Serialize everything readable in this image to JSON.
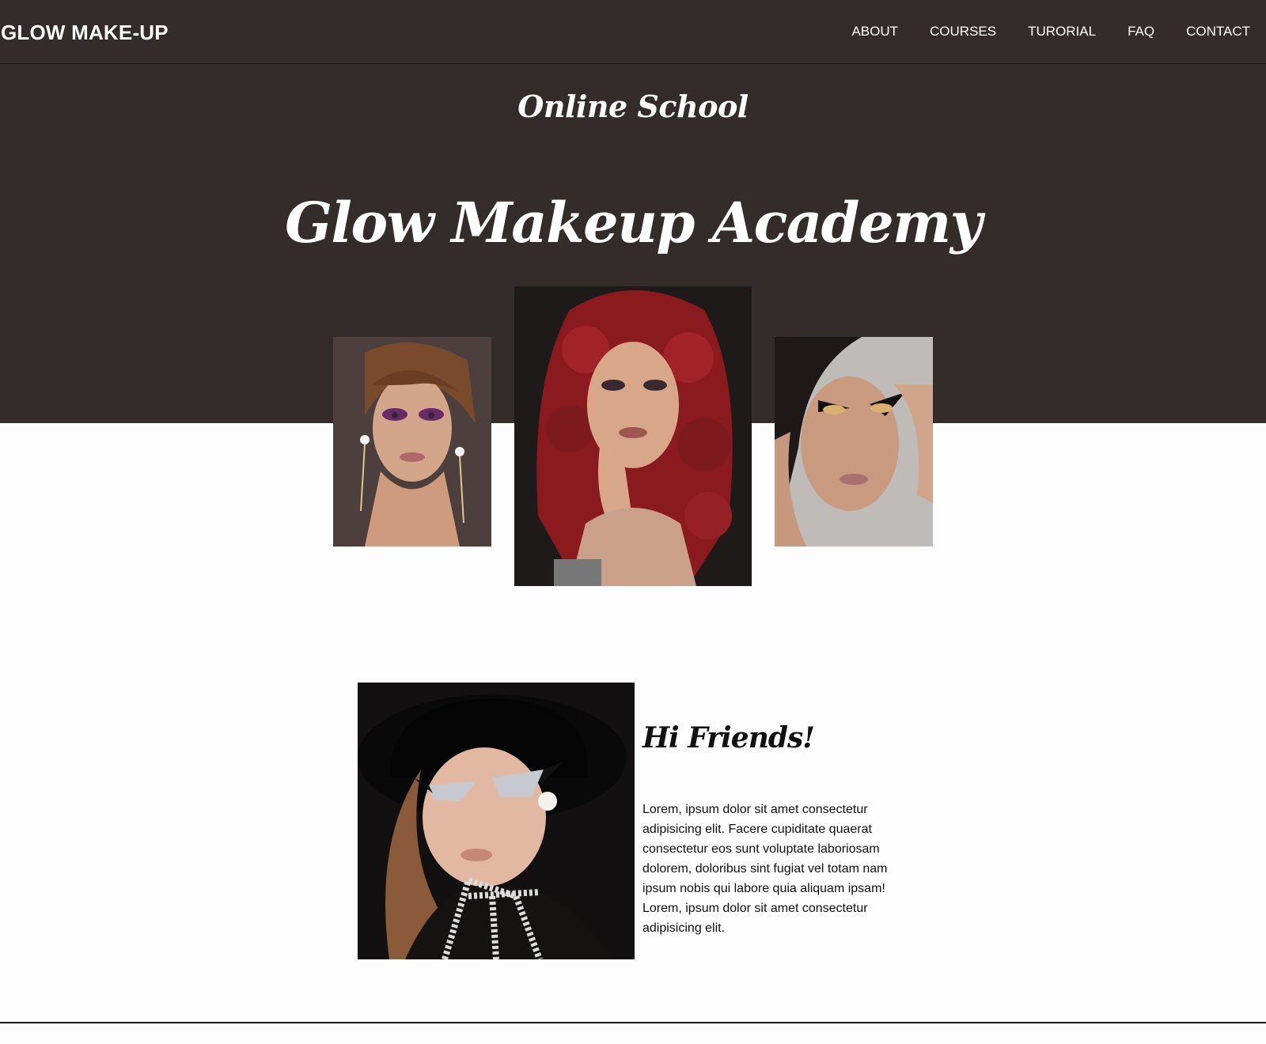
{
  "brand": "GLOW MAKE-UP",
  "nav": {
    "items": [
      "ABOUT",
      "COURSES",
      "TURORIAL",
      "FAQ",
      "CONTACT"
    ]
  },
  "hero": {
    "subtitle": "Online School",
    "title": "Glow Makeup Academy"
  },
  "gallery": {
    "photos": [
      "makeup-portrait-purple-smokey",
      "makeup-portrait-red-curls",
      "makeup-portrait-gold-eyeliner"
    ]
  },
  "intro": {
    "heading": "Hi Friends!",
    "text": "Lorem, ipsum dolor sit amet consectetur adipisicing elit. Facere cupiditate quaerat consectetur eos sunt voluptate laboriosam dolorem, doloribus sint fugiat vel totam nam ipsum nobis qui labore quia aliquam ipsam! Lorem, ipsum dolor sit amet consectetur adipisicing elit.",
    "photo": "makeup-portrait-black-hat"
  },
  "colors": {
    "hero_background": "#342c2b",
    "page_background": "#fdfdfd",
    "text_light": "#ffffff",
    "text_dark": "#111111"
  }
}
